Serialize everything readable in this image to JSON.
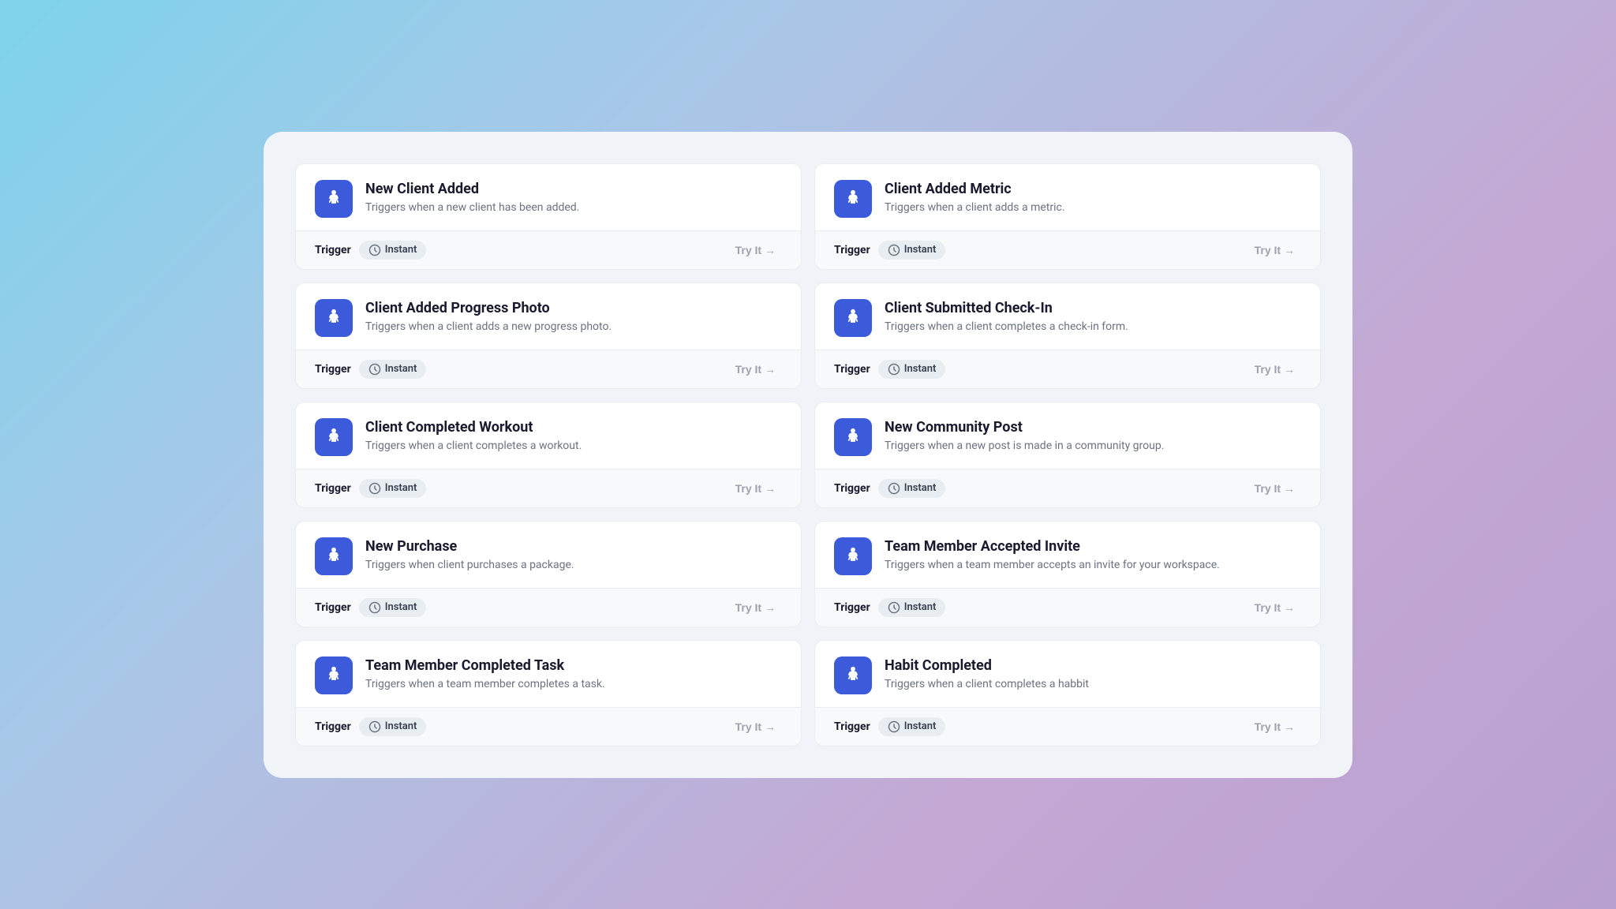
{
  "cards": [
    {
      "id": "new-client-added",
      "title": "New Client Added",
      "description": "Triggers when a new client has been added.",
      "trigger_label": "Trigger",
      "badge_label": "Instant",
      "try_it_label": "Try It →"
    },
    {
      "id": "client-added-metric",
      "title": "Client Added Metric",
      "description": "Triggers when a client adds a metric.",
      "trigger_label": "Trigger",
      "badge_label": "Instant",
      "try_it_label": "Try It →"
    },
    {
      "id": "client-added-progress-photo",
      "title": "Client Added Progress Photo",
      "description": "Triggers when a client adds a new progress photo.",
      "trigger_label": "Trigger",
      "badge_label": "Instant",
      "try_it_label": "Try It →"
    },
    {
      "id": "client-submitted-check-in",
      "title": "Client Submitted Check-In",
      "description": "Triggers when a client completes a check-in form.",
      "trigger_label": "Trigger",
      "badge_label": "Instant",
      "try_it_label": "Try It →"
    },
    {
      "id": "client-completed-workout",
      "title": "Client Completed Workout",
      "description": "Triggers when a client completes a workout.",
      "trigger_label": "Trigger",
      "badge_label": "Instant",
      "try_it_label": "Try It →"
    },
    {
      "id": "new-community-post",
      "title": "New Community Post",
      "description": "Triggers when a new post is made in a community group.",
      "trigger_label": "Trigger",
      "badge_label": "Instant",
      "try_it_label": "Try It →"
    },
    {
      "id": "new-purchase",
      "title": "New Purchase",
      "description": "Triggers when client purchases a package.",
      "trigger_label": "Trigger",
      "badge_label": "Instant",
      "try_it_label": "Try It →"
    },
    {
      "id": "team-member-accepted-invite",
      "title": "Team Member Accepted Invite",
      "description": "Triggers when a team member accepts an invite for your workspace.",
      "trigger_label": "Trigger",
      "badge_label": "Instant",
      "try_it_label": "Try It →"
    },
    {
      "id": "team-member-completed-task",
      "title": "Team Member Completed Task",
      "description": "Triggers when a team member completes a task.",
      "trigger_label": "Trigger",
      "badge_label": "Instant",
      "try_it_label": "Try It →"
    },
    {
      "id": "habit-completed",
      "title": "Habit Completed",
      "description": "Triggers when a client completes a habbit",
      "trigger_label": "Trigger",
      "badge_label": "Instant",
      "try_it_label": "Try It →"
    }
  ]
}
